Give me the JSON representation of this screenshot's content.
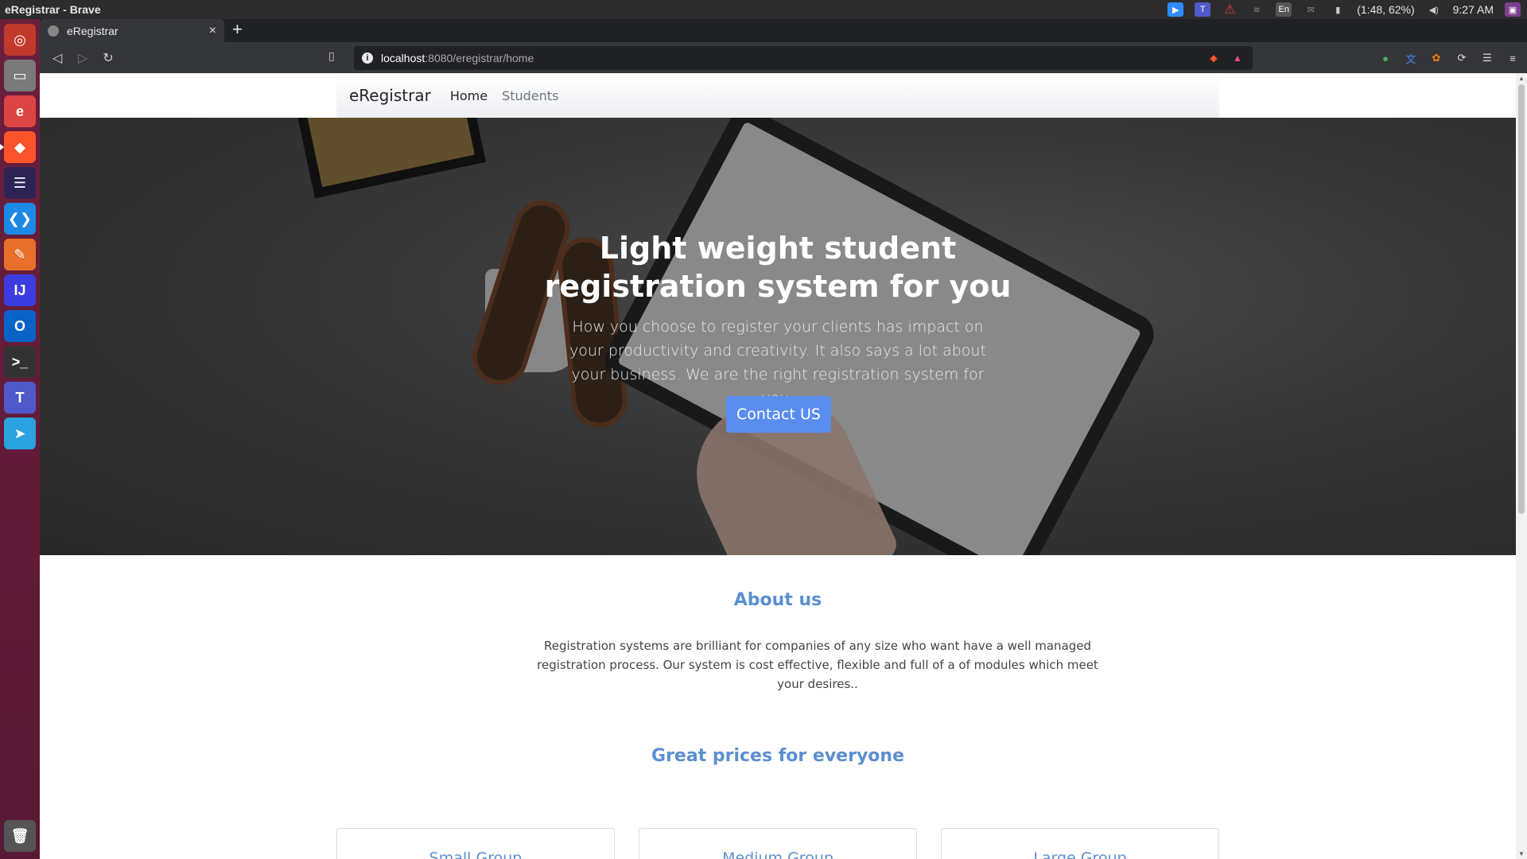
{
  "os": {
    "window_title": "eRegistrar - Brave",
    "tray": {
      "keyboard": "En",
      "battery": "(1:48, 62%)",
      "clock": "9:27 AM"
    }
  },
  "browser": {
    "tab_title": "eRegistrar",
    "tab_close": "×",
    "new_tab": "+",
    "url_host": "localhost",
    "url_path": ":8080/eregistrar/home"
  },
  "site": {
    "brand": "eRegistrar",
    "nav": [
      {
        "label": "Home",
        "active": true
      },
      {
        "label": "Students",
        "active": false
      }
    ],
    "hero": {
      "title": "Light weight student registration system for you",
      "subtitle": "How you choose to register your clients has impact on your productivity and creativity. It also says a lot about your business. We are the right registration system for you.",
      "button": "Contact US"
    },
    "about": {
      "heading": "About us",
      "text": "Registration systems are brilliant for companies of any size who want have a well managed registration process. Our system is cost effective, flexible and full of a of modules which meet your desires.."
    },
    "pricing": {
      "heading": "Great prices for everyone",
      "cards": [
        {
          "title": "Small Group"
        },
        {
          "title": "Medium Group"
        },
        {
          "title": "Large Group"
        }
      ]
    }
  },
  "colors": {
    "accent": "#5b8fcf",
    "button": "#5a8def",
    "launcher": "#6a1f3d"
  }
}
